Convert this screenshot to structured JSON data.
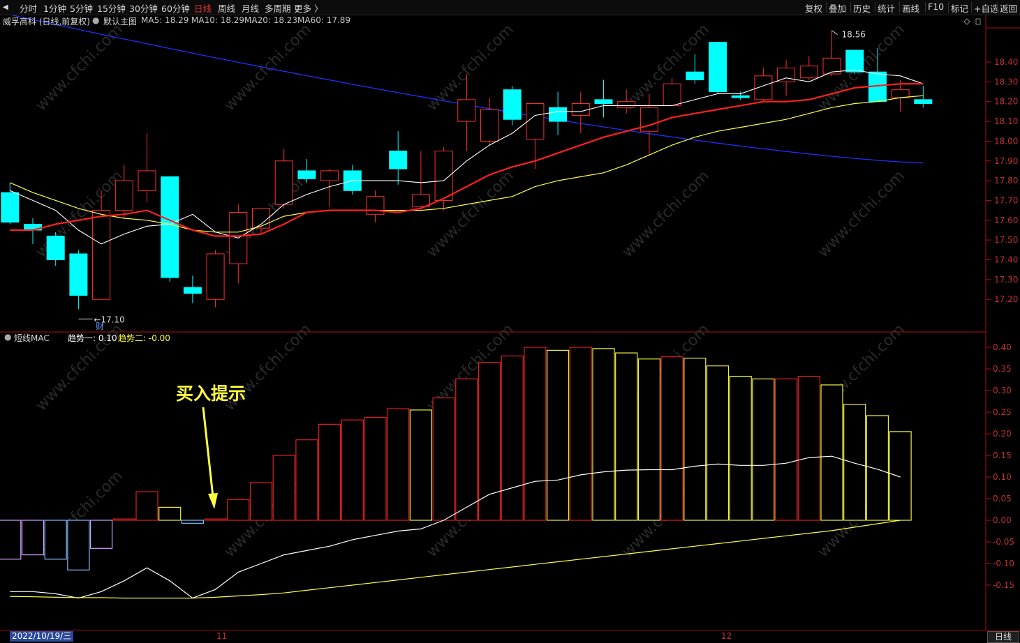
{
  "toolbar": {
    "left_items": [
      "分时",
      "1分钟",
      "5分钟",
      "15分钟",
      "30分钟",
      "60分钟",
      "日线",
      "周线",
      "月线",
      "多周期",
      "更多 〉"
    ],
    "active_item": "日线",
    "right_items": [
      "复权",
      "叠加",
      "历史",
      "统计",
      "画线",
      "F10",
      "标记",
      "+自选",
      "返回"
    ]
  },
  "main_panel": {
    "title": "威孚高科 (日线,前复权)",
    "indicator_name": "默认主图",
    "ma_labels": [
      {
        "text": "MA5: 18.29",
        "color": "#ffffff"
      },
      {
        "text": "MA10: 18.29",
        "color": "#ff2020"
      },
      {
        "text": "MA20: 18.23",
        "color": "#ffff40"
      },
      {
        "text": "MA60: 17.89",
        "color": "#3040ff"
      }
    ],
    "high_label": "18.56",
    "low_label": "17.10",
    "event_marker": "财",
    "y_ticks": [
      "18.40",
      "18.30",
      "18.20",
      "18.10",
      "18.00",
      "17.90",
      "17.80",
      "17.70",
      "17.60",
      "17.50",
      "17.40",
      "17.30",
      "17.20"
    ]
  },
  "sub_panel": {
    "indicator_name": "短线MAC",
    "line1_label": "趋势一: 0.10",
    "line2_label": "趋势二: -0.00",
    "annotation": "买入提示",
    "y_ticks": [
      "0.40",
      "0.35",
      "0.30",
      "0.25",
      "0.20",
      "0.15",
      "0.10",
      "0.05",
      "0.00",
      "-0.05",
      "-0.10",
      "-0.15"
    ]
  },
  "bottom": {
    "date": "2022/10/19/三",
    "month_marks": [
      "11",
      "12"
    ],
    "period_tab": "日线"
  },
  "colors": {
    "up": "#ff3030",
    "down": "#00ffff",
    "ma5": "#ffffff",
    "ma10": "#ff2020",
    "ma20": "#ffff40",
    "ma60": "#2030ff",
    "hist_red": "#e02020",
    "hist_yellow": "#f0f040",
    "hist_blue": "#80c0ff",
    "hist_violet": "#d0a0ff",
    "grid": "#b01010",
    "annotation": "#ffff40"
  },
  "chart_data": [
    {
      "type": "candlestick",
      "title": "威孚高科 (日线,前复权)",
      "ylim": [
        17.14,
        18.62
      ],
      "candles": [
        {
          "o": 17.74,
          "h": 17.79,
          "l": 17.58,
          "c": 17.59
        },
        {
          "o": 17.58,
          "h": 17.61,
          "l": 17.48,
          "c": 17.55
        },
        {
          "o": 17.52,
          "h": 17.54,
          "l": 17.37,
          "c": 17.4
        },
        {
          "o": 17.43,
          "h": 17.45,
          "l": 17.15,
          "c": 17.22
        },
        {
          "o": 17.2,
          "h": 17.75,
          "l": 17.2,
          "c": 17.65
        },
        {
          "o": 17.65,
          "h": 17.88,
          "l": 17.61,
          "c": 17.8
        },
        {
          "o": 17.75,
          "h": 18.04,
          "l": 17.69,
          "c": 17.85
        },
        {
          "o": 17.82,
          "h": 17.82,
          "l": 17.29,
          "c": 17.31
        },
        {
          "o": 17.26,
          "h": 17.32,
          "l": 17.18,
          "c": 17.23
        },
        {
          "o": 17.2,
          "h": 17.45,
          "l": 17.16,
          "c": 17.43
        },
        {
          "o": 17.38,
          "h": 17.68,
          "l": 17.28,
          "c": 17.64
        },
        {
          "o": 17.56,
          "h": 17.66,
          "l": 17.53,
          "c": 17.66
        },
        {
          "o": 17.68,
          "h": 17.96,
          "l": 17.66,
          "c": 17.9
        },
        {
          "o": 17.85,
          "h": 17.91,
          "l": 17.79,
          "c": 17.81
        },
        {
          "o": 17.8,
          "h": 17.86,
          "l": 17.67,
          "c": 17.85
        },
        {
          "o": 17.85,
          "h": 17.88,
          "l": 17.73,
          "c": 17.75
        },
        {
          "o": 17.63,
          "h": 17.75,
          "l": 17.59,
          "c": 17.72
        },
        {
          "o": 17.95,
          "h": 18.05,
          "l": 17.78,
          "c": 17.86
        },
        {
          "o": 17.67,
          "h": 17.95,
          "l": 17.66,
          "c": 17.73
        },
        {
          "o": 17.7,
          "h": 17.97,
          "l": 17.65,
          "c": 17.95
        },
        {
          "o": 18.1,
          "h": 18.34,
          "l": 17.95,
          "c": 18.21
        },
        {
          "o": 18.0,
          "h": 18.22,
          "l": 17.98,
          "c": 18.16
        },
        {
          "o": 18.26,
          "h": 18.28,
          "l": 18.08,
          "c": 18.11
        },
        {
          "o": 18.01,
          "h": 18.19,
          "l": 17.86,
          "c": 18.19
        },
        {
          "o": 18.17,
          "h": 18.25,
          "l": 18.03,
          "c": 18.1
        },
        {
          "o": 18.13,
          "h": 18.25,
          "l": 18.04,
          "c": 18.19
        },
        {
          "o": 18.21,
          "h": 18.31,
          "l": 18.12,
          "c": 18.19
        },
        {
          "o": 18.17,
          "h": 18.26,
          "l": 18.14,
          "c": 18.2
        },
        {
          "o": 18.05,
          "h": 18.24,
          "l": 17.93,
          "c": 18.17
        },
        {
          "o": 18.18,
          "h": 18.32,
          "l": 18.18,
          "c": 18.29
        },
        {
          "o": 18.35,
          "h": 18.44,
          "l": 18.29,
          "c": 18.31
        },
        {
          "o": 18.5,
          "h": 18.5,
          "l": 18.24,
          "c": 18.25
        },
        {
          "o": 18.23,
          "h": 18.25,
          "l": 18.21,
          "c": 18.22
        },
        {
          "o": 18.21,
          "h": 18.37,
          "l": 18.2,
          "c": 18.33
        },
        {
          "o": 18.3,
          "h": 18.41,
          "l": 18.23,
          "c": 18.37
        },
        {
          "o": 18.32,
          "h": 18.43,
          "l": 18.31,
          "c": 18.38
        },
        {
          "o": 18.34,
          "h": 18.56,
          "l": 18.33,
          "c": 18.42
        },
        {
          "o": 18.46,
          "h": 18.46,
          "l": 18.34,
          "c": 18.35
        },
        {
          "o": 18.35,
          "h": 18.47,
          "l": 18.2,
          "c": 18.2
        },
        {
          "o": 18.22,
          "h": 18.31,
          "l": 18.15,
          "c": 18.26
        },
        {
          "o": 18.21,
          "h": 18.28,
          "l": 18.17,
          "c": 18.19
        }
      ],
      "ma5": [
        17.75,
        17.7,
        17.65,
        17.55,
        17.48,
        17.53,
        17.57,
        17.58,
        17.63,
        17.54,
        17.51,
        17.58,
        17.68,
        17.73,
        17.77,
        17.8,
        17.8,
        17.8,
        17.79,
        17.8,
        17.9,
        17.98,
        18.04,
        18.13,
        18.15,
        18.15,
        18.18,
        18.18,
        18.18,
        18.18,
        18.21,
        18.24,
        18.24,
        18.28,
        18.32,
        18.3,
        18.35,
        18.36,
        18.34,
        18.33,
        18.29
      ],
      "ma10": [
        17.55,
        17.55,
        17.58,
        17.6,
        17.62,
        17.63,
        17.65,
        17.6,
        17.55,
        17.52,
        17.52,
        17.53,
        17.58,
        17.64,
        17.65,
        17.65,
        17.65,
        17.64,
        17.66,
        17.71,
        17.77,
        17.83,
        17.87,
        17.9,
        17.94,
        17.98,
        18.02,
        18.05,
        18.08,
        18.12,
        18.14,
        18.16,
        18.18,
        18.2,
        18.2,
        18.21,
        18.24,
        18.27,
        18.28,
        18.29,
        18.29
      ],
      "ma20": [
        17.79,
        17.74,
        17.7,
        17.66,
        17.63,
        17.61,
        17.6,
        17.58,
        17.55,
        17.54,
        17.54,
        17.57,
        17.62,
        17.64,
        17.65,
        17.65,
        17.65,
        17.65,
        17.65,
        17.66,
        17.68,
        17.7,
        17.72,
        17.77,
        17.8,
        17.82,
        17.84,
        17.88,
        17.93,
        17.98,
        18.02,
        18.05,
        18.07,
        18.09,
        18.11,
        18.14,
        18.17,
        18.19,
        18.2,
        18.22,
        18.23
      ],
      "ma60_start": 18.64,
      "ma60_end": 17.89
    },
    {
      "type": "bar",
      "title": "短线MAC",
      "ylim": [
        -0.2,
        0.42
      ],
      "values": [
        -0.09,
        -0.08,
        -0.09,
        -0.115,
        -0.065,
        0.003,
        0.066,
        0.03,
        -0.007,
        0.003,
        0.048,
        0.087,
        0.15,
        0.186,
        0.222,
        0.232,
        0.238,
        0.258,
        0.255,
        0.283,
        0.327,
        0.365,
        0.38,
        0.4,
        0.393,
        0.4,
        0.397,
        0.387,
        0.373,
        0.378,
        0.375,
        0.357,
        0.333,
        0.327,
        0.327,
        0.333,
        0.313,
        0.268,
        0.242,
        0.205
      ],
      "colors": [
        "violet",
        "violet",
        "blue",
        "blue",
        "violet",
        "red",
        "red",
        "yellow",
        "blue",
        "red",
        "red",
        "red",
        "red",
        "red",
        "red",
        "red",
        "red",
        "red",
        "yellow",
        "red",
        "red",
        "red",
        "red",
        "red",
        "yellow",
        "red",
        "yellow",
        "yellow",
        "yellow",
        "red",
        "yellow",
        "yellow",
        "yellow",
        "yellow",
        "red",
        "red",
        "yellow",
        "yellow",
        "yellow",
        "yellow"
      ],
      "series": [
        {
          "name": "趋势一",
          "values": [
            -0.165,
            -0.165,
            -0.17,
            -0.18,
            -0.165,
            -0.14,
            -0.11,
            -0.14,
            -0.18,
            -0.16,
            -0.12,
            -0.1,
            -0.08,
            -0.07,
            -0.06,
            -0.045,
            -0.035,
            -0.025,
            -0.02,
            0.0,
            0.03,
            0.06,
            0.075,
            0.09,
            0.093,
            0.105,
            0.112,
            0.116,
            0.117,
            0.117,
            0.125,
            0.13,
            0.127,
            0.127,
            0.132,
            0.145,
            0.148,
            0.132,
            0.118,
            0.1
          ]
        },
        {
          "name": "趋势二",
          "values": [
            -0.176,
            -0.177,
            -0.178,
            -0.179,
            -0.179,
            -0.18,
            -0.18,
            -0.18,
            -0.18,
            -0.178,
            -0.175,
            -0.172,
            -0.168,
            -0.162,
            -0.156,
            -0.15,
            -0.144,
            -0.138,
            -0.132,
            -0.126,
            -0.12,
            -0.114,
            -0.108,
            -0.102,
            -0.096,
            -0.09,
            -0.084,
            -0.078,
            -0.072,
            -0.066,
            -0.06,
            -0.054,
            -0.048,
            -0.042,
            -0.036,
            -0.03,
            -0.024,
            -0.016,
            -0.008,
            0.0
          ]
        }
      ]
    }
  ]
}
